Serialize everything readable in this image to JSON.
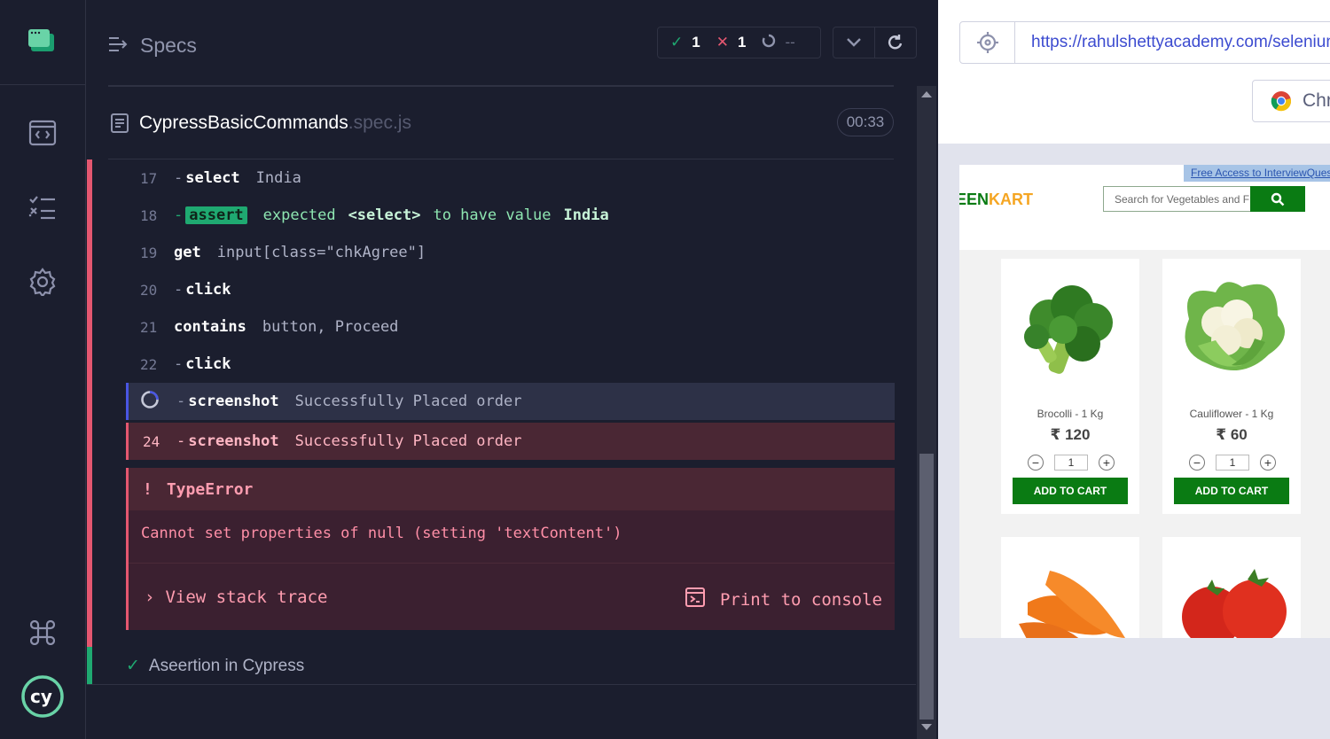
{
  "reporter": {
    "title": "Specs",
    "stats": {
      "passed": "1",
      "failed": "1",
      "pending": "--"
    },
    "spec": {
      "name": "CypressBasicCommands",
      "ext": ".spec.js",
      "duration": "00:33"
    }
  },
  "commands": [
    {
      "num": "17",
      "prefix": "-",
      "name": "select",
      "message": "India"
    },
    {
      "num": "18",
      "prefix": "-",
      "name": "assert",
      "message_pre": "expected",
      "strong1": "<select>",
      "message_mid": "to have value",
      "strong2": "India"
    },
    {
      "num": "19",
      "prefix": "",
      "name": "get",
      "message": "input[class=\"chkAgree\"]"
    },
    {
      "num": "20",
      "prefix": "-",
      "name": "click",
      "message": ""
    },
    {
      "num": "21",
      "prefix": "",
      "name": "contains",
      "message": "button, Proceed"
    },
    {
      "num": "22",
      "prefix": "-",
      "name": "click",
      "message": ""
    },
    {
      "num": "",
      "prefix": "-",
      "name": "screenshot",
      "message": "Successfully Placed order",
      "state": "running"
    },
    {
      "num": "24",
      "prefix": "-",
      "name": "screenshot",
      "message": "Successfully Placed order",
      "state": "failed"
    }
  ],
  "error": {
    "bang": "!",
    "type": "TypeError",
    "message": "Cannot set properties of null (setting 'textContent')",
    "stack_link": "View stack trace",
    "print_console": "Print to console"
  },
  "next_test": {
    "title": "Aseertion in Cypress"
  },
  "aut": {
    "url": "https://rahulshettyacademy.com/seleniumPractise/#/",
    "browser": "Chr"
  },
  "site": {
    "free_access": "Free Access to InterviewQues",
    "brand_green": "EEN",
    "brand_orange": "KART",
    "search_placeholder": "Search for Vegetables and Fruits",
    "products": [
      {
        "name": "Brocolli - 1 Kg",
        "price": "₹ 120",
        "qty": "1",
        "button": "ADD TO CART"
      },
      {
        "name": "Cauliflower - 1 Kg",
        "price": "₹ 60",
        "qty": "1",
        "button": "ADD TO CART"
      }
    ]
  },
  "colors": {
    "pass": "#1fa971",
    "fail": "#e45770",
    "running": "#4956e3",
    "site_green": "#0a7b13"
  }
}
